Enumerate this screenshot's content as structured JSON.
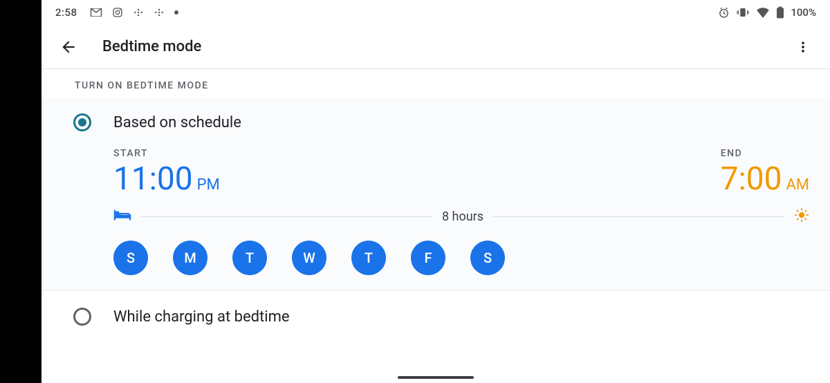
{
  "statusbar": {
    "time": "2:58",
    "battery_text": "100%"
  },
  "appbar": {
    "title": "Bedtime mode"
  },
  "section": {
    "label": "TURN ON BEDTIME MODE"
  },
  "schedule": {
    "option_label": "Based on schedule",
    "start_label": "START",
    "start_time": "11:00",
    "start_ampm": "PM",
    "end_label": "END",
    "end_time": "7:00",
    "end_ampm": "AM",
    "duration": "8 hours",
    "days": [
      "S",
      "M",
      "T",
      "W",
      "T",
      "F",
      "S"
    ]
  },
  "charging": {
    "option_label": "While charging at bedtime"
  },
  "colors": {
    "accent_blue": "#1a73e8",
    "accent_amber": "#f29900",
    "radio_selected": "#1a768c"
  }
}
